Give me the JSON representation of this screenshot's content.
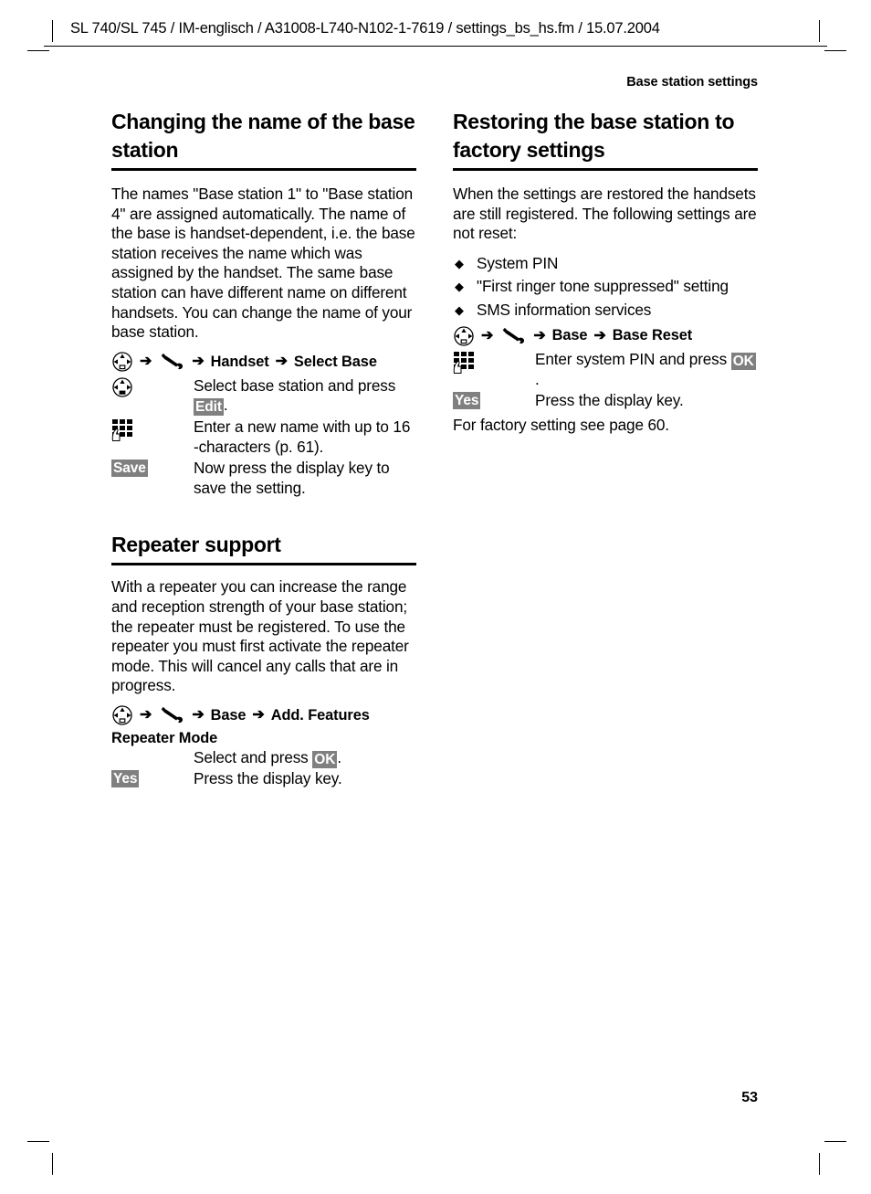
{
  "document": {
    "file_line": "SL 740/SL 745 / IM-englisch / A31008-L740-N102-1-7619 / settings_bs_hs.fm / 15.07.2004",
    "running_header": "Base station settings",
    "page_number": "53"
  },
  "left_column": {
    "section1": {
      "heading": "Changing the name of the base station",
      "body": "The names \"Base station 1\" to \"Base station 4\" are assigned automatically. The name of the base is handset-dependent, i.e. the base station receives the name which was assigned by the handset. The same base station can have different name on different handsets. You can change the name of your base station.",
      "menu_path": {
        "icon1": "navigation-key-icon",
        "arrow": "➔",
        "icon2": "settings-wrench-icon",
        "step1": "Handset",
        "step2": "Select Base"
      },
      "steps": [
        {
          "key_icon": "navigation-key-icon",
          "desc_before": "Select base station and press ",
          "key_label": "Edit",
          "desc_after": "."
        },
        {
          "key_icon": "keypad-icon",
          "desc_before": "Enter a new name with up to 16 -characters (p. 61).",
          "key_label": "",
          "desc_after": ""
        },
        {
          "key_icon": "display-key",
          "key_chip": "Save",
          "desc_before": "Now press the display key to save the setting.",
          "key_label": "",
          "desc_after": ""
        }
      ]
    },
    "section2": {
      "heading": "Repeater support",
      "body": "With a repeater you can increase the range and reception strength of your base station; the repeater must be registered. To use the repeater you must first activate the repeater mode. This will cancel any calls that are in progress.",
      "menu_path": {
        "icon1": "navigation-key-icon",
        "arrow": "➔",
        "icon2": "settings-wrench-icon",
        "step1": "Base",
        "step2": "Add. Features"
      },
      "subhead": "Repeater Mode",
      "steps": [
        {
          "key_icon": "none",
          "desc_before": "Select and press ",
          "key_label": "OK",
          "desc_after": "."
        },
        {
          "key_icon": "display-key",
          "key_chip": "Yes",
          "desc_before": "Press the display key.",
          "key_label": "",
          "desc_after": ""
        }
      ]
    }
  },
  "right_column": {
    "section1": {
      "heading": "Restoring the base station to factory settings",
      "body": "When the settings are restored the handsets are still registered. The following settings are not reset:",
      "bullets": [
        {
          "mark": "◆",
          "text": "System PIN"
        },
        {
          "mark": "◆",
          "text": "\"First ringer tone suppressed\" setting"
        },
        {
          "mark": "◆",
          "text": "SMS information services"
        }
      ],
      "menu_path": {
        "icon1": "navigation-key-icon",
        "arrow": "➔",
        "icon2": "settings-wrench-icon",
        "step1": "Base",
        "step2": "Base Reset"
      },
      "steps": [
        {
          "key_icon": "keypad-icon",
          "desc_before": "Enter system PIN and press ",
          "key_label": "OK",
          "desc_after": "."
        },
        {
          "key_icon": "display-key",
          "key_chip": "Yes",
          "desc_before": "Press the display key.",
          "key_label": "",
          "desc_after": ""
        }
      ],
      "footnote": "For factory setting see page 60."
    }
  },
  "colors": {
    "text": "#000000",
    "background": "#ffffff",
    "display_key_bg": "#808080",
    "display_key_fg": "#ffffff"
  }
}
